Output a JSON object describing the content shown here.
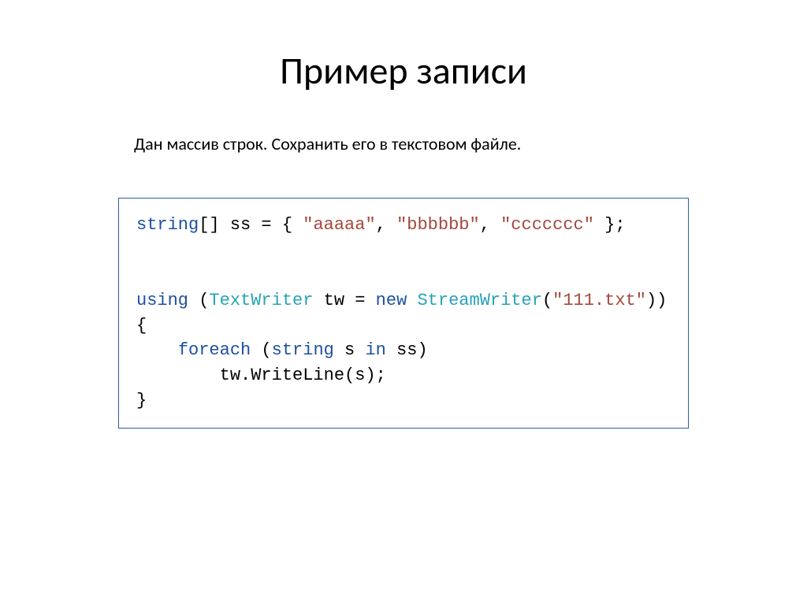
{
  "title": "Пример записи",
  "description": "Дан массив строк. Сохранить его в текстовом файле.",
  "code": {
    "l1": {
      "kw1": "string",
      "rest1": "[] ss = { ",
      "s1": "\"aaaaa\"",
      "c1": ", ",
      "s2": "\"bbbbbb\"",
      "c2": ", ",
      "s3": "\"ccccccc\"",
      "rest2": " };"
    },
    "l3": {
      "kw1": "using",
      "p1": " (",
      "cls1": "TextWriter",
      "mid": " tw = ",
      "kw2": "new",
      "sp": " ",
      "cls2": "StreamWriter",
      "p2": "(",
      "s1": "\"111.txt\"",
      "p3": "))"
    },
    "l4": "{",
    "l5": {
      "indent": "    ",
      "kw1": "foreach",
      "p1": " (",
      "kw2": "string",
      "mid": " s ",
      "kw3": "in",
      "rest": " ss)"
    },
    "l6": "        tw.WriteLine(s);",
    "l7": "}"
  }
}
